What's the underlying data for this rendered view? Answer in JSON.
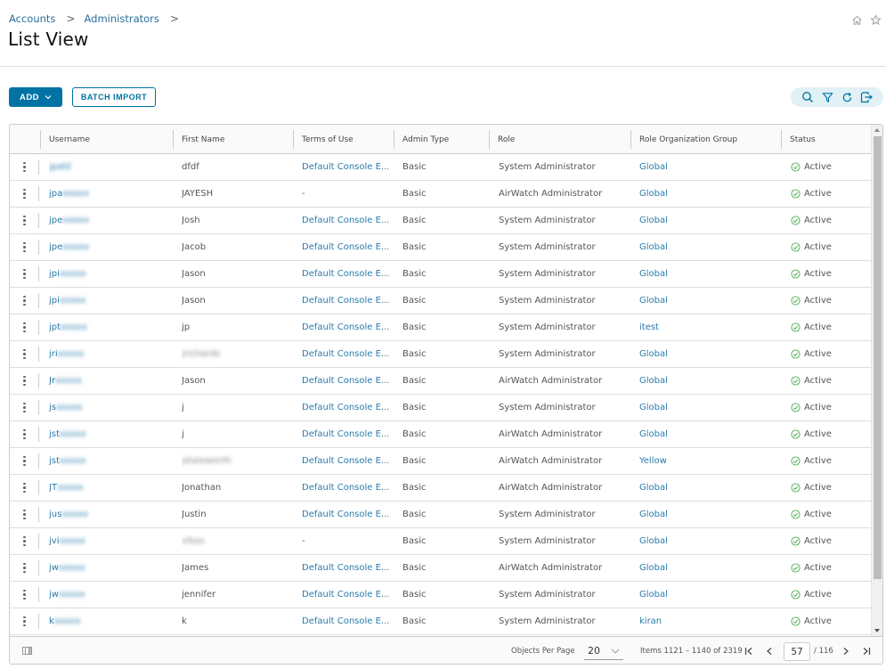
{
  "header": {
    "breadcrumb": [
      "Accounts",
      "Administrators"
    ],
    "breadcrumb_separator": ">",
    "title": "List View",
    "icons": [
      "home-icon",
      "star-icon"
    ]
  },
  "toolbar": {
    "add_label": "ADD",
    "batch_import_label": "BATCH IMPORT",
    "actions": [
      "search-icon",
      "filter-icon",
      "refresh-icon",
      "export-icon"
    ],
    "accent_color": "#0072a3"
  },
  "table": {
    "columns": [
      "Username",
      "First Name",
      "Terms of Use",
      "Admin Type",
      "Role",
      "Role Organization Group",
      "Status"
    ],
    "rows": [
      {
        "username": "jpatil",
        "username_visible": "",
        "first_name": "dfdf",
        "first_blur": false,
        "terms": "Default Console E...",
        "admin_type": "Basic",
        "role": "System Administrator",
        "org_group": "Global",
        "status": "Active"
      },
      {
        "username": "jpa",
        "username_visible": "jpa",
        "first_name": "JAYESH",
        "first_blur": false,
        "terms": "-",
        "admin_type": "Basic",
        "role": "AirWatch Administrator",
        "org_group": "Global",
        "status": "Active"
      },
      {
        "username": "jpe",
        "username_visible": "jpe",
        "first_name": "Josh",
        "first_blur": false,
        "terms": "Default Console E...",
        "admin_type": "Basic",
        "role": "System Administrator",
        "org_group": "Global",
        "status": "Active"
      },
      {
        "username": "jpe",
        "username_visible": "jpe",
        "first_name": "Jacob",
        "first_blur": false,
        "terms": "Default Console E...",
        "admin_type": "Basic",
        "role": "System Administrator",
        "org_group": "Global",
        "status": "Active"
      },
      {
        "username": "jpi",
        "username_visible": "jpi",
        "first_name": "Jason",
        "first_blur": false,
        "terms": "Default Console E...",
        "admin_type": "Basic",
        "role": "System Administrator",
        "org_group": "Global",
        "status": "Active"
      },
      {
        "username": "jpi",
        "username_visible": "jpi",
        "first_name": "Jason",
        "first_blur": false,
        "terms": "Default Console E...",
        "admin_type": "Basic",
        "role": "System Administrator",
        "org_group": "Global",
        "status": "Active"
      },
      {
        "username": "jpt",
        "username_visible": "jpt",
        "first_name": "jp",
        "first_blur": false,
        "terms": "Default Console E...",
        "admin_type": "Basic",
        "role": "System Administrator",
        "org_group": "itest",
        "status": "Active"
      },
      {
        "username": "jri",
        "username_visible": "jri",
        "first_name": "jrichards",
        "first_blur": true,
        "terms": "Default Console E...",
        "admin_type": "Basic",
        "role": "System Administrator",
        "org_group": "Global",
        "status": "Active"
      },
      {
        "username": "Jr",
        "username_visible": "Jr",
        "first_name": "Jason",
        "first_blur": false,
        "terms": "Default Console E...",
        "admin_type": "Basic",
        "role": "AirWatch Administrator",
        "org_group": "Global",
        "status": "Active"
      },
      {
        "username": "js",
        "username_visible": "js",
        "first_name": "j",
        "first_blur": false,
        "terms": "Default Console E...",
        "admin_type": "Basic",
        "role": "System Administrator",
        "org_group": "Global",
        "status": "Active"
      },
      {
        "username": "jst",
        "username_visible": "jst",
        "first_name": "j",
        "first_blur": false,
        "terms": "Default Console E...",
        "admin_type": "Basic",
        "role": "AirWatch Administrator",
        "org_group": "Global",
        "status": "Active"
      },
      {
        "username": "jst",
        "username_visible": "jst",
        "first_name": "jstaleworth",
        "first_blur": true,
        "terms": "Default Console E...",
        "admin_type": "Basic",
        "role": "AirWatch Administrator",
        "org_group": "Yellow",
        "status": "Active"
      },
      {
        "username": "JT",
        "username_visible": "JT",
        "first_name": "Jonathan",
        "first_blur": false,
        "terms": "Default Console E...",
        "admin_type": "Basic",
        "role": "AirWatch Administrator",
        "org_group": "Global",
        "status": "Active"
      },
      {
        "username": "jus",
        "username_visible": "jus",
        "first_name": "Justin",
        "first_blur": false,
        "terms": "Default Console E...",
        "admin_type": "Basic",
        "role": "System Administrator",
        "org_group": "Global",
        "status": "Active"
      },
      {
        "username": "jvi",
        "username_visible": "jvi",
        "first_name": "vikas",
        "first_blur": true,
        "terms": "-",
        "admin_type": "Basic",
        "role": "System Administrator",
        "org_group": "Global",
        "status": "Active"
      },
      {
        "username": "jw",
        "username_visible": "jw",
        "first_name": "James",
        "first_blur": false,
        "terms": "Default Console E...",
        "admin_type": "Basic",
        "role": "AirWatch Administrator",
        "org_group": "Global",
        "status": "Active"
      },
      {
        "username": "jw",
        "username_visible": "jw",
        "first_name": "jennifer",
        "first_blur": false,
        "terms": "Default Console E...",
        "admin_type": "Basic",
        "role": "System Administrator",
        "org_group": "Global",
        "status": "Active"
      },
      {
        "username": "k",
        "username_visible": "k",
        "first_name": "k",
        "first_blur": false,
        "terms": "Default Console E...",
        "admin_type": "Basic",
        "role": "System Administrator",
        "org_group": "kiran",
        "status": "Active"
      }
    ],
    "status_color": "#4caf50",
    "link_color": "#2a7bab"
  },
  "footer": {
    "objects_per_page_label": "Objects Per Page",
    "objects_per_page_value": "20",
    "items_text": "Items 1121 – 1140 of 2319",
    "current_page": "57",
    "total_pages": "/ 116"
  }
}
